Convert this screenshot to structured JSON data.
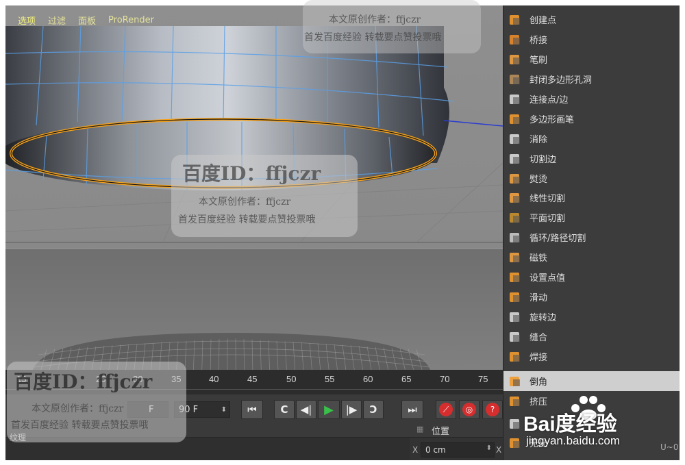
{
  "viewport": {
    "menu": [
      "选项",
      "过滤",
      "面板",
      "ProRender"
    ]
  },
  "timeline": {
    "ticks": [
      "15",
      "25",
      "30",
      "35",
      "40",
      "45",
      "50",
      "55",
      "60",
      "65",
      "70",
      "75"
    ]
  },
  "transport": {
    "frame_input": "90 F",
    "frame_input_left": "F"
  },
  "bottom": {
    "left_label": "纹理",
    "coords_header": "位置",
    "coord_axis": "X",
    "coord_value": "0 cm",
    "coord_axis2": "X",
    "right_small": "U~0"
  },
  "menu_items": [
    {
      "label": "创建点",
      "icon": "create-point-icon",
      "color": "#f29a2e"
    },
    {
      "label": "桥接",
      "icon": "bridge-icon",
      "color": "#e88a2a"
    },
    {
      "label": "笔刷",
      "icon": "brush-icon",
      "color": "#f0a040"
    },
    {
      "label": "封闭多边形孔洞",
      "icon": "close-hole-icon",
      "color": "#b98f5a"
    },
    {
      "label": "连接点/边",
      "icon": "connect-icon",
      "color": "#d8d8d8"
    },
    {
      "label": "多边形画笔",
      "icon": "polygon-pen-icon",
      "color": "#f29a2e"
    },
    {
      "label": "消除",
      "icon": "dissolve-icon",
      "color": "#d8d8d8"
    },
    {
      "label": "切割边",
      "icon": "cut-edges-icon",
      "color": "#d8d8d8"
    },
    {
      "label": "熨烫",
      "icon": "iron-icon",
      "color": "#f0a040"
    },
    {
      "label": "线性切割",
      "icon": "line-cut-icon",
      "color": "#f0a040"
    },
    {
      "label": "平面切割",
      "icon": "plane-cut-icon",
      "color": "#c8902e"
    },
    {
      "label": "循环/路径切割",
      "icon": "loop-cut-icon",
      "color": "#c8c8c8"
    },
    {
      "label": "磁铁",
      "icon": "magnet-icon",
      "color": "#f0a040"
    },
    {
      "label": "设置点值",
      "icon": "set-point-value-icon",
      "color": "#f29a2e"
    },
    {
      "label": "滑动",
      "icon": "slide-icon",
      "color": "#f29a2e"
    },
    {
      "label": "旋转边",
      "icon": "spin-edge-icon",
      "color": "#d8d8d8"
    },
    {
      "label": "缝合",
      "icon": "stitch-icon",
      "color": "#d8d8d8"
    },
    {
      "label": "焊接",
      "icon": "weld-icon",
      "color": "#f29a2e"
    },
    {
      "label": "倒角",
      "icon": "bevel-icon",
      "color": "#f29a2e",
      "selected": true
    },
    {
      "label": "挤压",
      "icon": "extrude-icon",
      "color": "#f29a2e"
    },
    {
      "label": "",
      "icon": "extrude-inner-icon",
      "color": "#d8d8d8"
    },
    {
      "label": "无光",
      "icon": "matrix-extrude-icon",
      "color": "#f29a2e"
    }
  ],
  "watermarks": {
    "baidu_id": "百度ID：ffjczr",
    "author_line": "本文原创作者：ffjczr",
    "publish_line": "首发百度经验 转载要点赞投票哦",
    "baidu_logo": "Bai度经验",
    "baidu_url": "jingyan.baidu.com"
  }
}
